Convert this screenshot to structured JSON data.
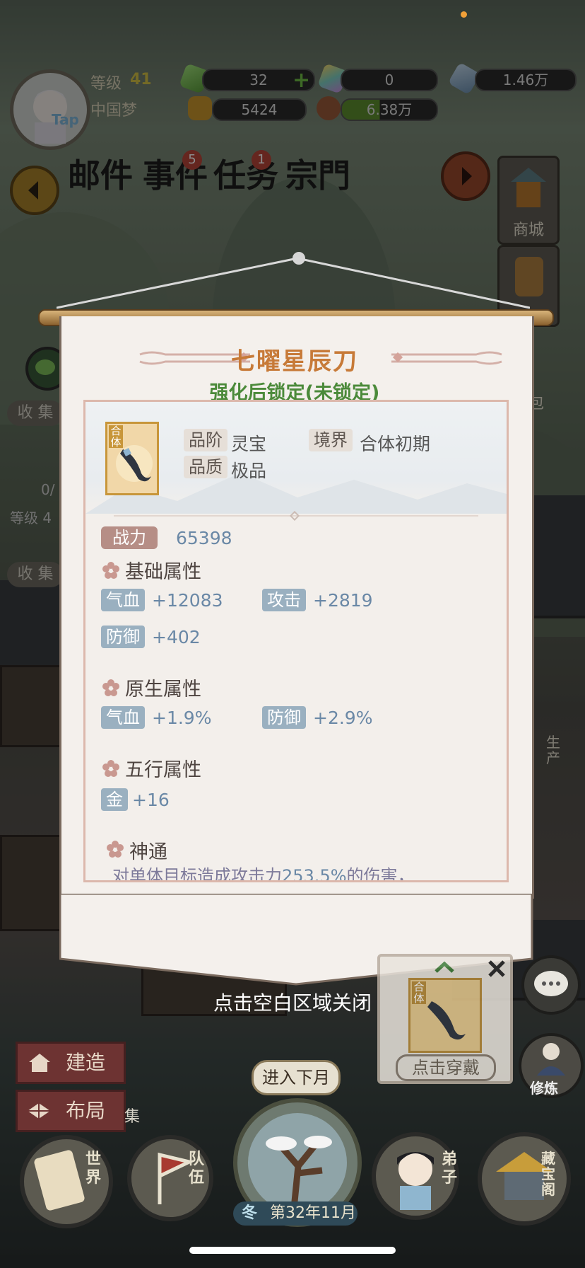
{
  "top_bar": {
    "level_label": "等级",
    "level_value": "41",
    "server_name": "中国梦",
    "avatar_tap": "Tap",
    "resources": [
      {
        "value": "32",
        "icon": "green-crystal-icon"
      },
      {
        "value": "0",
        "icon": "rainbow-crystal-icon"
      },
      {
        "value": "1.46万",
        "icon": "blue-gem-icon"
      },
      {
        "value": "5424",
        "icon": "gold-ingot-icon"
      },
      {
        "value": "6.38万",
        "icon": "meat-icon"
      }
    ]
  },
  "nav": {
    "mail": "邮件",
    "events": "事件",
    "events_badge": "5",
    "tasks": "任务",
    "tasks_badge": "1",
    "clan": "宗門"
  },
  "side": {
    "shop": "商城",
    "bag": "包",
    "produce": "生产",
    "practice": "修炼",
    "collect_1": "收 集",
    "collect_2": "收 集",
    "level_short": "等级 4",
    "progress_short": "0/",
    "collect_3": "集"
  },
  "item_panel": {
    "name": "七曜星辰刀",
    "lock_status": "强化后锁定(未锁定)",
    "grade_label": "品阶",
    "grade_value": "灵宝",
    "quality_label": "品质",
    "quality_value": "极品",
    "realm_label": "境界",
    "realm_value": "合体初期",
    "item_badge": "合体",
    "power_label": "战力",
    "power_value": "65398",
    "base_title": "基础属性",
    "base_attrs": [
      {
        "label": "气血",
        "value": "+12083"
      },
      {
        "label": "攻击",
        "value": "+2819"
      },
      {
        "label": "防御",
        "value": "+402"
      }
    ],
    "native_title": "原生属性",
    "native_attrs": [
      {
        "label": "气血",
        "value": "+1.9%"
      },
      {
        "label": "防御",
        "value": "+2.9%"
      }
    ],
    "wuxing_title": "五行属性",
    "wuxing_attrs": [
      {
        "label": "金",
        "value": "+16"
      }
    ],
    "skill_title": "神通",
    "skill_desc_pre": "对单体目标造成攻击力",
    "skill_desc_pct": "253.5%",
    "skill_desc_post": "的伤害，"
  },
  "close_hint": "点击空白区域关闭",
  "equip_popup": {
    "button": "点击穿戴",
    "item_badge": "合体"
  },
  "bottom": {
    "build": "建造",
    "layout": "布局",
    "next_month": "进入下月",
    "season": "冬",
    "date": "第32年11月",
    "world": "世界",
    "team": "队伍",
    "disciple": "弟子",
    "treasure": "藏宝阁"
  }
}
